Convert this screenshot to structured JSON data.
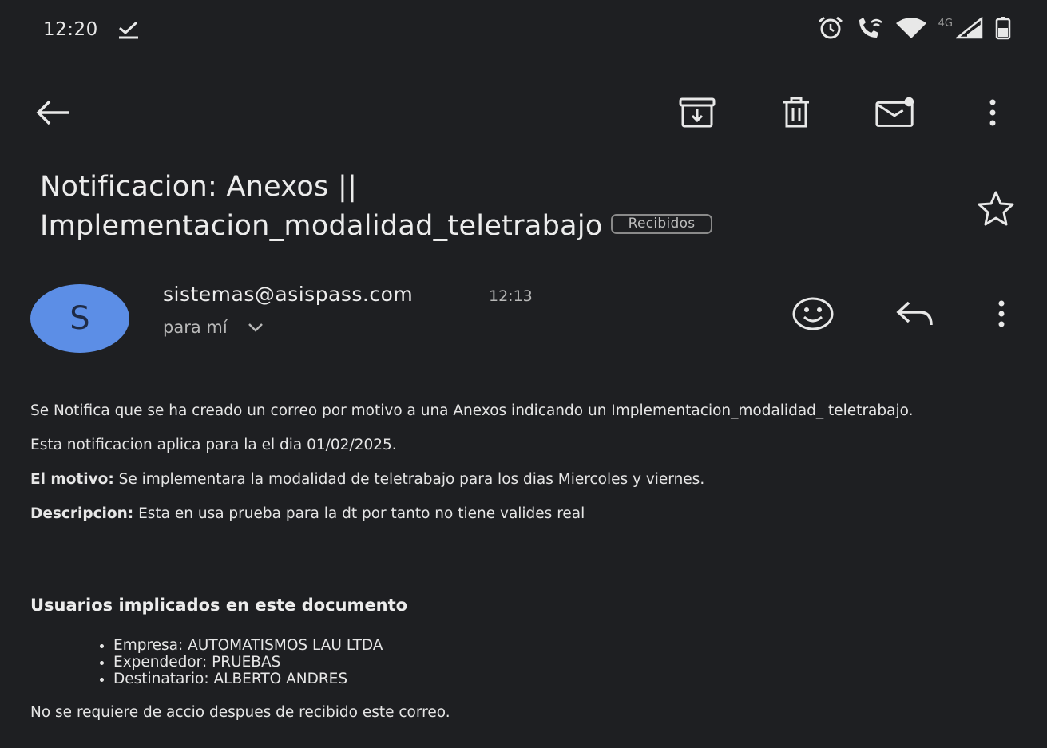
{
  "status_bar": {
    "time": "12:20",
    "network_label": "4G",
    "icons": [
      "check-icon",
      "alarm-icon",
      "wifi-call-icon",
      "wifi-icon",
      "signal-icon",
      "battery-icon"
    ]
  },
  "toolbar": {
    "icons": [
      "back-arrow-icon",
      "archive-icon",
      "delete-icon",
      "mark-unread-icon",
      "more-vert-icon"
    ]
  },
  "email": {
    "subject_line1": "Notificacion: Anexos ||",
    "subject_line2": "Implementacion_modalidad_teletrabajo",
    "label": "Recibidos",
    "sender": {
      "avatar_letter": "S",
      "avatar_color": "#5c8ee6",
      "address": "sistemas@asispass.com",
      "time": "12:13",
      "recipient": "para mí"
    },
    "body": {
      "p1": "Se Notifica que se ha creado un correo por motivo a una Anexos indicando un Implementacion_modalidad_ teletrabajo.",
      "p2": "Esta notificacion aplica para la el dia 01/02/2025.",
      "motivo_label": "El motivo:",
      "motivo_text": " Se implementara la modalidad de teletrabajo para los dias Miercoles y viernes.",
      "descripcion_label": "Descripcion:",
      "descripcion_text": " Esta en usa prueba para la dt por tanto no tiene valides real",
      "users_title": "Usuarios implicados en este documento",
      "users": [
        "Empresa: AUTOMATISMOS LAU LTDA",
        "Expendedor: PRUEBAS",
        "Destinatario: ALBERTO ANDRES"
      ],
      "footer": "No se requiere de accio despues de recibido este correo."
    }
  },
  "colors": {
    "background": "#1e1f22",
    "text": "#e3e3e3",
    "avatar": "#5c8ee6"
  }
}
